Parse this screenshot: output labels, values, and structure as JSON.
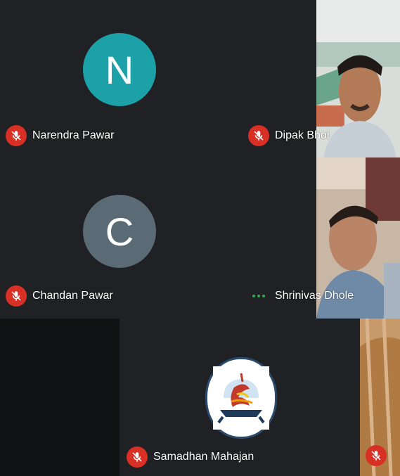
{
  "participants": [
    {
      "name": "Narendra Pawar",
      "initial": "N",
      "avatar_color": "#1ba1a7",
      "mic": "muted"
    },
    {
      "name": "Dipak Bhoi",
      "mic": "muted"
    },
    {
      "name": "Chandan Pawar",
      "initial": "C",
      "avatar_color": "#5a6b76",
      "mic": "muted"
    },
    {
      "name": "Shrinivas Dhole",
      "mic": "speaking"
    },
    {
      "name": "Samadhan Mahajan",
      "mic": "muted"
    }
  ],
  "icons": {
    "muted": "mic-off-icon",
    "speaking": "audio-dots-icon"
  },
  "colors": {
    "tile_background": "#202124",
    "mic_off_red": "#d93025",
    "speaking_green": "#34a853"
  }
}
